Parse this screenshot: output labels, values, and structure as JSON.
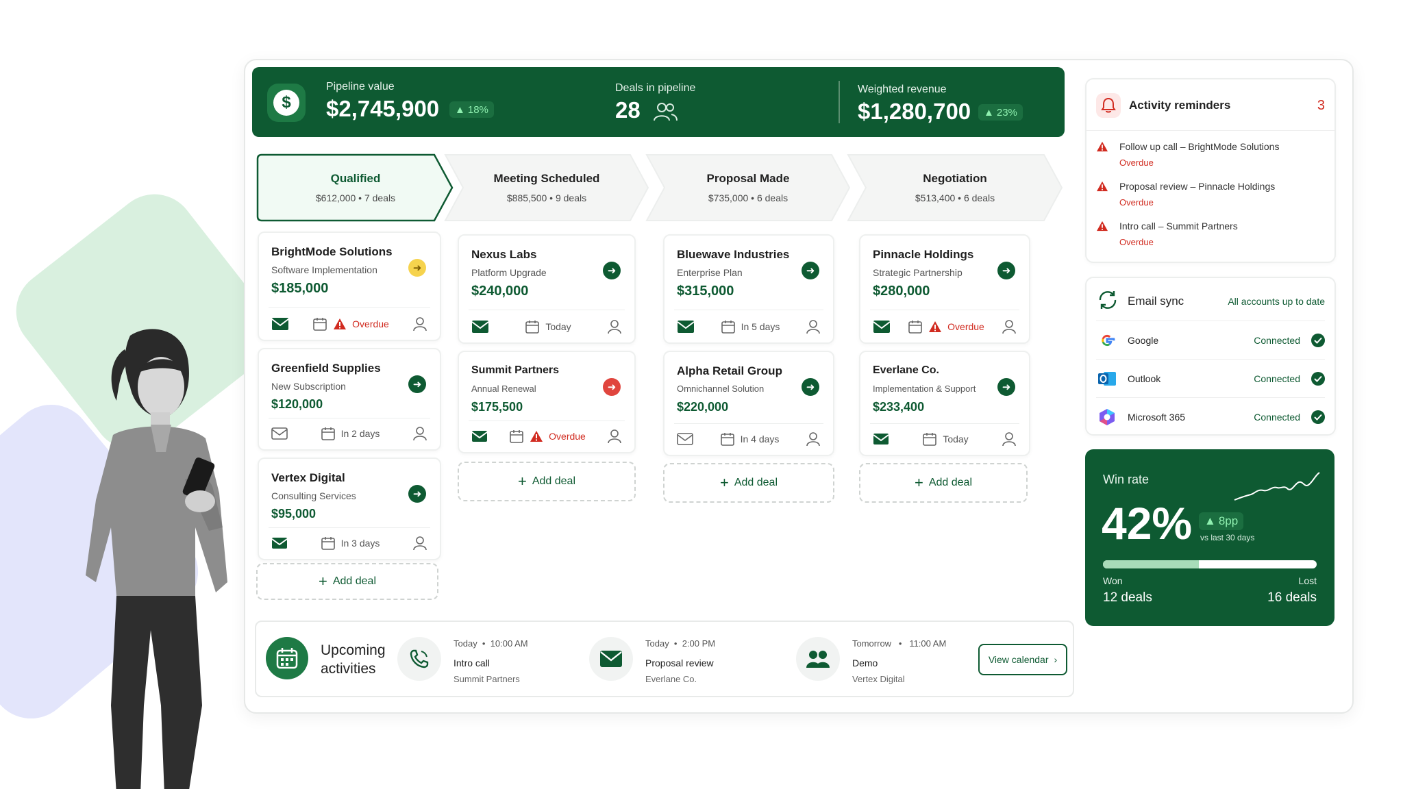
{
  "summary": {
    "pipeline_label": "Pipeline value",
    "pipeline_value": "$2,745,900",
    "pipeline_change": "18%",
    "deals_label": "Deals in pipeline",
    "deals_value": "28",
    "weighted_label": "Weighted revenue",
    "weighted_value": "$1,280,700",
    "weighted_change": "23%",
    "currency_symbol": "$"
  },
  "stages": [
    {
      "name": "Qualified",
      "amount": "$612,000",
      "count": "7 deals"
    },
    {
      "name": "Meeting Scheduled",
      "amount": "$885,500",
      "count": "9 deals"
    },
    {
      "name": "Proposal Made",
      "amount": "$735,000",
      "count": "6 deals"
    },
    {
      "name": "Negotiation",
      "amount": "$513,400",
      "count": "6 deals"
    }
  ],
  "stage_separator": "•",
  "columns": [
    [
      {
        "company": "BrightMode Solutions",
        "product": "Software Implementation",
        "amount": "$185,000",
        "due": "Overdue"
      },
      {
        "company": "Greenfield Supplies",
        "product": "New Subscription",
        "amount": "$120,000",
        "due": "In 2 days"
      },
      {
        "company": "Vertex Digital",
        "product": "Consulting Services",
        "amount": "$95,000",
        "due": "In 3 days"
      }
    ],
    [
      {
        "company": "Nexus Labs",
        "product": "Platform Upgrade",
        "amount": "$240,000",
        "due": "Today"
      },
      {
        "company": "Summit Partners",
        "product": "Annual Renewal",
        "amount": "$175,500",
        "due": "Overdue"
      }
    ],
    [
      {
        "company": "Bluewave Industries",
        "product": "Enterprise Plan",
        "amount": "$315,000",
        "due": "In 5 days"
      },
      {
        "company": "Alpha Retail Group",
        "product": "Omnichannel Solution",
        "amount": "$220,000",
        "due": "In 4 days"
      }
    ],
    [
      {
        "company": "Pinnacle Holdings",
        "product": "Strategic Partnership",
        "amount": "$280,000",
        "due": "Overdue"
      },
      {
        "company": "Everlane Co.",
        "product": "Implementation & Support",
        "amount": "$233,400",
        "due": "Today"
      }
    ]
  ],
  "add_deal_label": "Add deal",
  "reminders": {
    "title": "Activity reminders",
    "count": "3",
    "items": [
      {
        "text": "Follow up call – BrightMode Solutions",
        "status": "Overdue"
      },
      {
        "text": "Proposal review – Pinnacle Holdings",
        "status": "Overdue"
      },
      {
        "text": "Intro call – Summit Partners",
        "status": "Overdue"
      }
    ]
  },
  "email_sync": {
    "title": "Email sync",
    "status": "All accounts up to date",
    "accounts": [
      {
        "name": "Google",
        "state": "Connected"
      },
      {
        "name": "Outlook",
        "state": "Connected"
      },
      {
        "name": "Microsoft 365",
        "state": "Connected"
      }
    ]
  },
  "win_rate": {
    "label": "Win rate",
    "value": "42%",
    "change": "8pp",
    "period": "vs last 30 days",
    "won_label": "Won",
    "won_value": "12 deals",
    "lost_label": "Lost",
    "lost_value": "16 deals",
    "won_fraction": 0.45
  },
  "upcoming": {
    "title_line1": "Upcoming",
    "title_line2": "activities",
    "view_calendar": "View calendar",
    "items": [
      {
        "day": "Today",
        "time": "10:00 AM",
        "title": "Intro call",
        "company": "Summit Partners",
        "icon": "phone-icon"
      },
      {
        "day": "Today",
        "time": "2:00 PM",
        "title": "Proposal review",
        "company": "Everlane Co.",
        "icon": "mail-icon"
      },
      {
        "day": "Tomorrow",
        "time": "11:00 AM",
        "title": "Demo",
        "company": "Vertex Digital",
        "icon": "people-icon"
      }
    ]
  },
  "colors": {
    "brand": "#0e5a32",
    "danger": "#d12b20",
    "accent_light": "#8ff0b0"
  }
}
